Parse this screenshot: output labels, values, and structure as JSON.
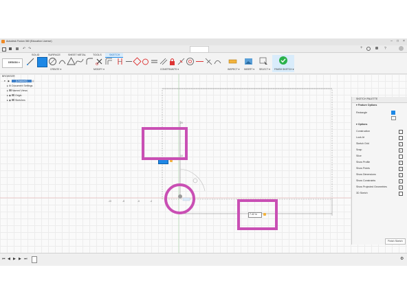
{
  "app": {
    "title": "Autodesk Fusion 360 (Education License)",
    "document_tab": "Untitled*(1)"
  },
  "tabs": [
    "SOLID",
    "SURFACE",
    "SHEET METAL",
    "TOOLS",
    "SKETCH"
  ],
  "active_tab": "SKETCH",
  "ribbon": {
    "workspace": "DESIGN",
    "groups": {
      "create": "CREATE",
      "modify": "MODIFY",
      "constraints": "CONSTRAINTS",
      "inspect": "INSPECT",
      "insert": "INSERT",
      "select": "SELECT",
      "finish": "FINISH SKETCH"
    }
  },
  "browser": {
    "title": "BROWSER",
    "root": "(Unsaved)",
    "items": [
      "Document Settings",
      "Named Views",
      "Origin",
      "Sketches"
    ]
  },
  "sketch_palette": {
    "title": "SKETCH PALETTE",
    "feature_options_label": "Feature Options",
    "feature_option": "Rectangle",
    "options_label": "Options",
    "options": [
      {
        "label": "Construction",
        "checked": false
      },
      {
        "label": "Look At",
        "checked": false
      },
      {
        "label": "Sketch Grid",
        "checked": true
      },
      {
        "label": "Snap",
        "checked": true
      },
      {
        "label": "Slice",
        "checked": false
      },
      {
        "label": "Show Profile",
        "checked": true
      },
      {
        "label": "Show Points",
        "checked": true
      },
      {
        "label": "Show Dimensions",
        "checked": true
      },
      {
        "label": "Show Constraints",
        "checked": true
      },
      {
        "label": "Show Projected Geometries",
        "checked": true
      },
      {
        "label": "3D Sketch",
        "checked": false
      }
    ],
    "finish_button": "Finish Sketch"
  },
  "viewcube": {
    "face": "TOP"
  },
  "dimension_inputs": {
    "vertical_value": "",
    "horizontal_value": "7.42 in"
  },
  "comments": {
    "label": "COMMENTS"
  },
  "colors": {
    "highlight": "#c94fb4",
    "accent_blue": "#1e88e5",
    "finish_green": "#2bb24c"
  }
}
